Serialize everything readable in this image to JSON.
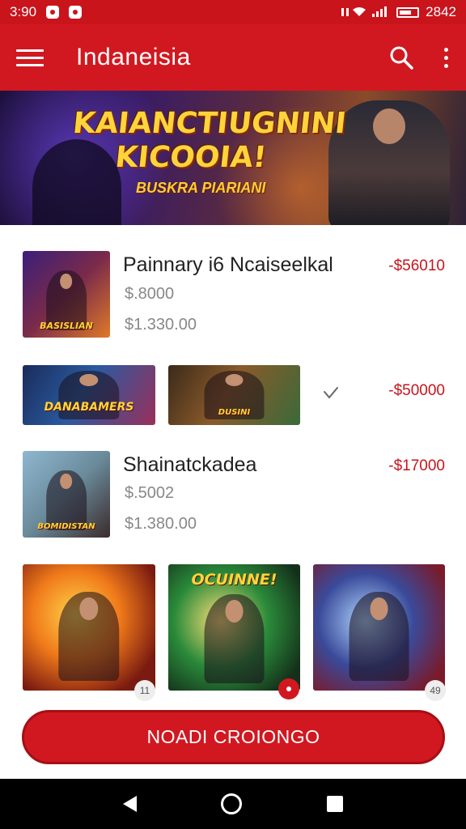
{
  "status_bar": {
    "time": "3:90",
    "right_text": "2842"
  },
  "app_bar": {
    "title": "Indaneisia"
  },
  "banner": {
    "title": "KAIANCTIUGNINI KICOOIA!",
    "subtitle": "BUSKRA PIARIANI"
  },
  "items": [
    {
      "title": "Painnary i6 Ncaiseelkal",
      "line1": "$.8000",
      "line2": "$1.330.00",
      "price": "-$56010",
      "thumb_caption": "BASISLIAN"
    },
    {
      "price": "-$50000",
      "thumb_captions": [
        "DANABAMERS",
        "DUSINI"
      ]
    },
    {
      "title": "Shainatckadea",
      "line1": "$.5002",
      "line2": "$1.380.00",
      "price": "-$17000",
      "thumb_caption": "BOMIDISTAN"
    }
  ],
  "grid": {
    "captions": [
      "",
      "OCUINNE!",
      ""
    ],
    "badges": [
      "11",
      "",
      "49"
    ]
  },
  "cta": {
    "label": "NOADI CROIONGO"
  },
  "icons": {
    "menu": "hamburger-icon",
    "search": "search-icon",
    "more": "more-vert-icon",
    "check": "check-icon",
    "back": "nav-back-icon",
    "home": "nav-home-icon",
    "recents": "nav-recents-icon"
  },
  "colors": {
    "primary": "#d11820",
    "price": "#c8141c"
  }
}
